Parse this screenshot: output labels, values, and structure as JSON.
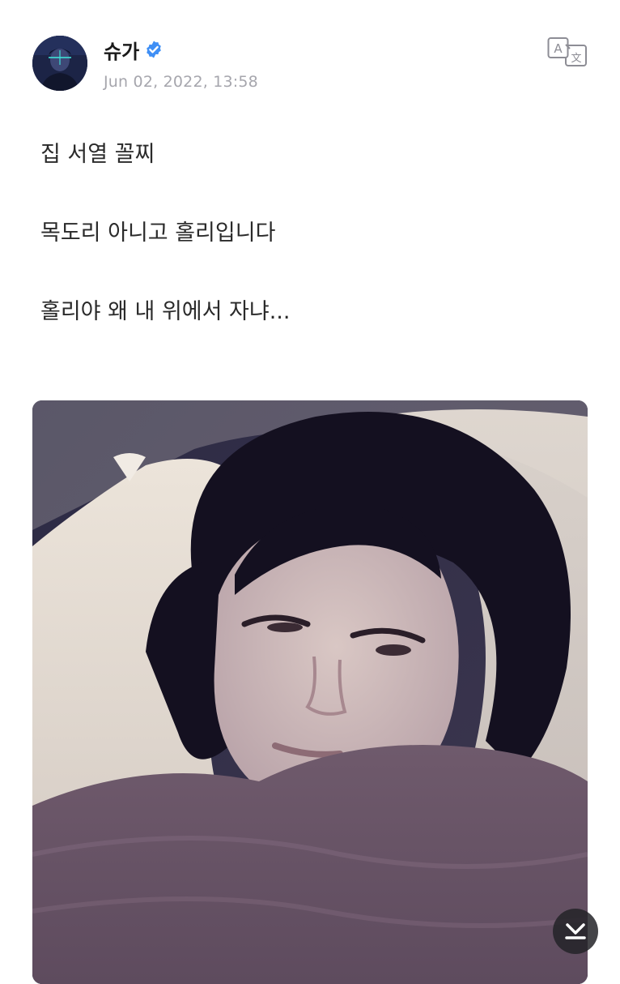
{
  "post": {
    "author": {
      "name": "슈가",
      "verified": true,
      "avatar_icon": "profile-photo"
    },
    "timestamp": "Jun 02, 2022, 13:58",
    "text_lines": [
      "집 서열 꼴찌",
      "목도리 아니고 홀리입니다",
      "홀리야 왜 내 위에서 자냐..."
    ],
    "translate_icon": "translate-icon",
    "photo_icon": "bedtime-selfie-photo",
    "scroll_icon": "scroll-down-icon"
  },
  "colors": {
    "verified": "#3f8ff5",
    "timestamp": "#a6a6ad",
    "text": "#2a2a2a",
    "scroll_button": "#232328"
  }
}
